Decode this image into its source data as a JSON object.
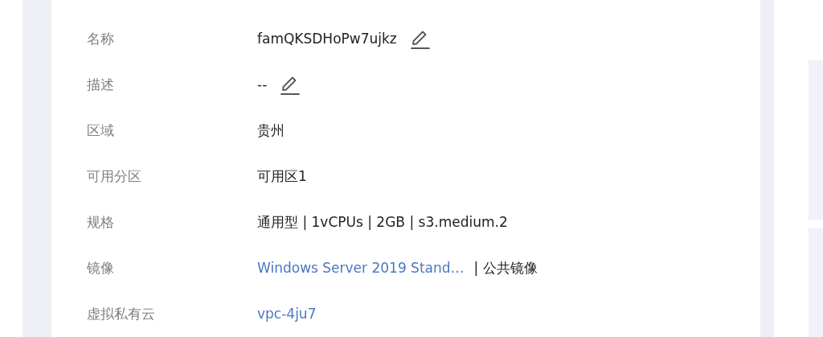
{
  "details": [
    {
      "label": "名称",
      "kind": "editable",
      "value": "famQKSDHoPw7ujkz"
    },
    {
      "label": "描述",
      "kind": "editable",
      "value": "--"
    },
    {
      "label": "区域",
      "kind": "text",
      "value": "贵州"
    },
    {
      "label": "可用分区",
      "kind": "text",
      "value": "可用区1"
    },
    {
      "label": "规格",
      "kind": "text",
      "value": "通用型 | 1vCPUs | 2GB | s3.medium.2"
    },
    {
      "label": "镜像",
      "kind": "link",
      "value": "Windows Server 2019 Stand…",
      "suffix": "| 公共镜像"
    },
    {
      "label": "虚拟私有云",
      "kind": "link",
      "value": "vpc-4ju7"
    }
  ]
}
